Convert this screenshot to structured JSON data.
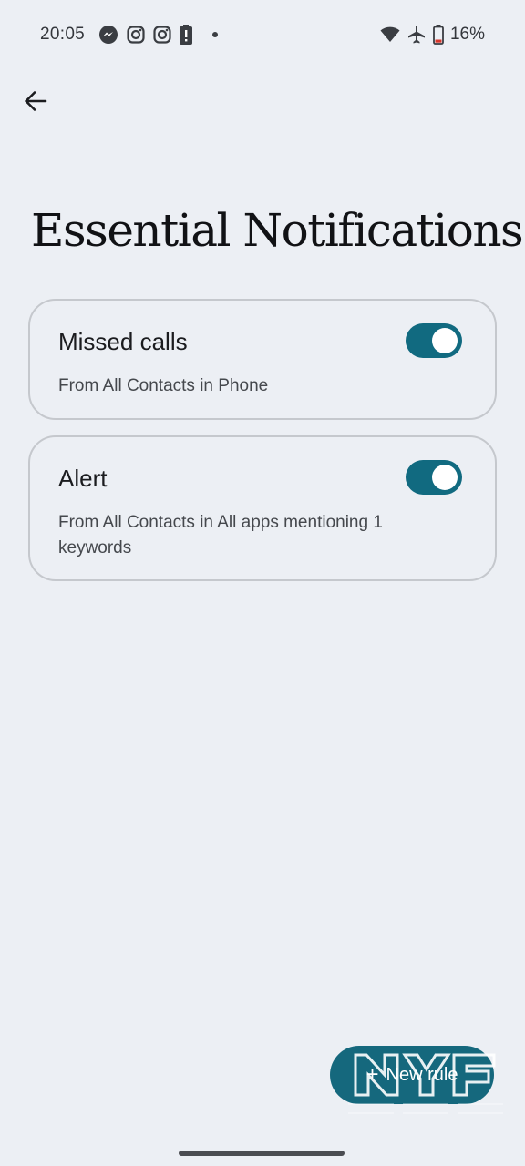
{
  "status_bar": {
    "time": "20:05",
    "battery_percent": "16%",
    "notification_icons": [
      "messenger-icon",
      "instagram-icon",
      "instagram-icon",
      "battery-alert-icon",
      "dot-icon"
    ],
    "system_icons": [
      "wifi-icon",
      "airplane-mode-icon",
      "battery-icon"
    ]
  },
  "page": {
    "title": "Essential Notifications"
  },
  "rules": [
    {
      "title": "Missed calls",
      "description": "From All Contacts in Phone",
      "enabled": true
    },
    {
      "title": "Alert",
      "description": "From All Contacts in All apps mentioning 1 keywords",
      "enabled": true
    }
  ],
  "fab": {
    "icon": "plus-icon",
    "plus": "+",
    "label": "New rule"
  },
  "colors": {
    "background": "#eceff4",
    "accent": "#116a80",
    "card_border": "#c5c8cd"
  }
}
